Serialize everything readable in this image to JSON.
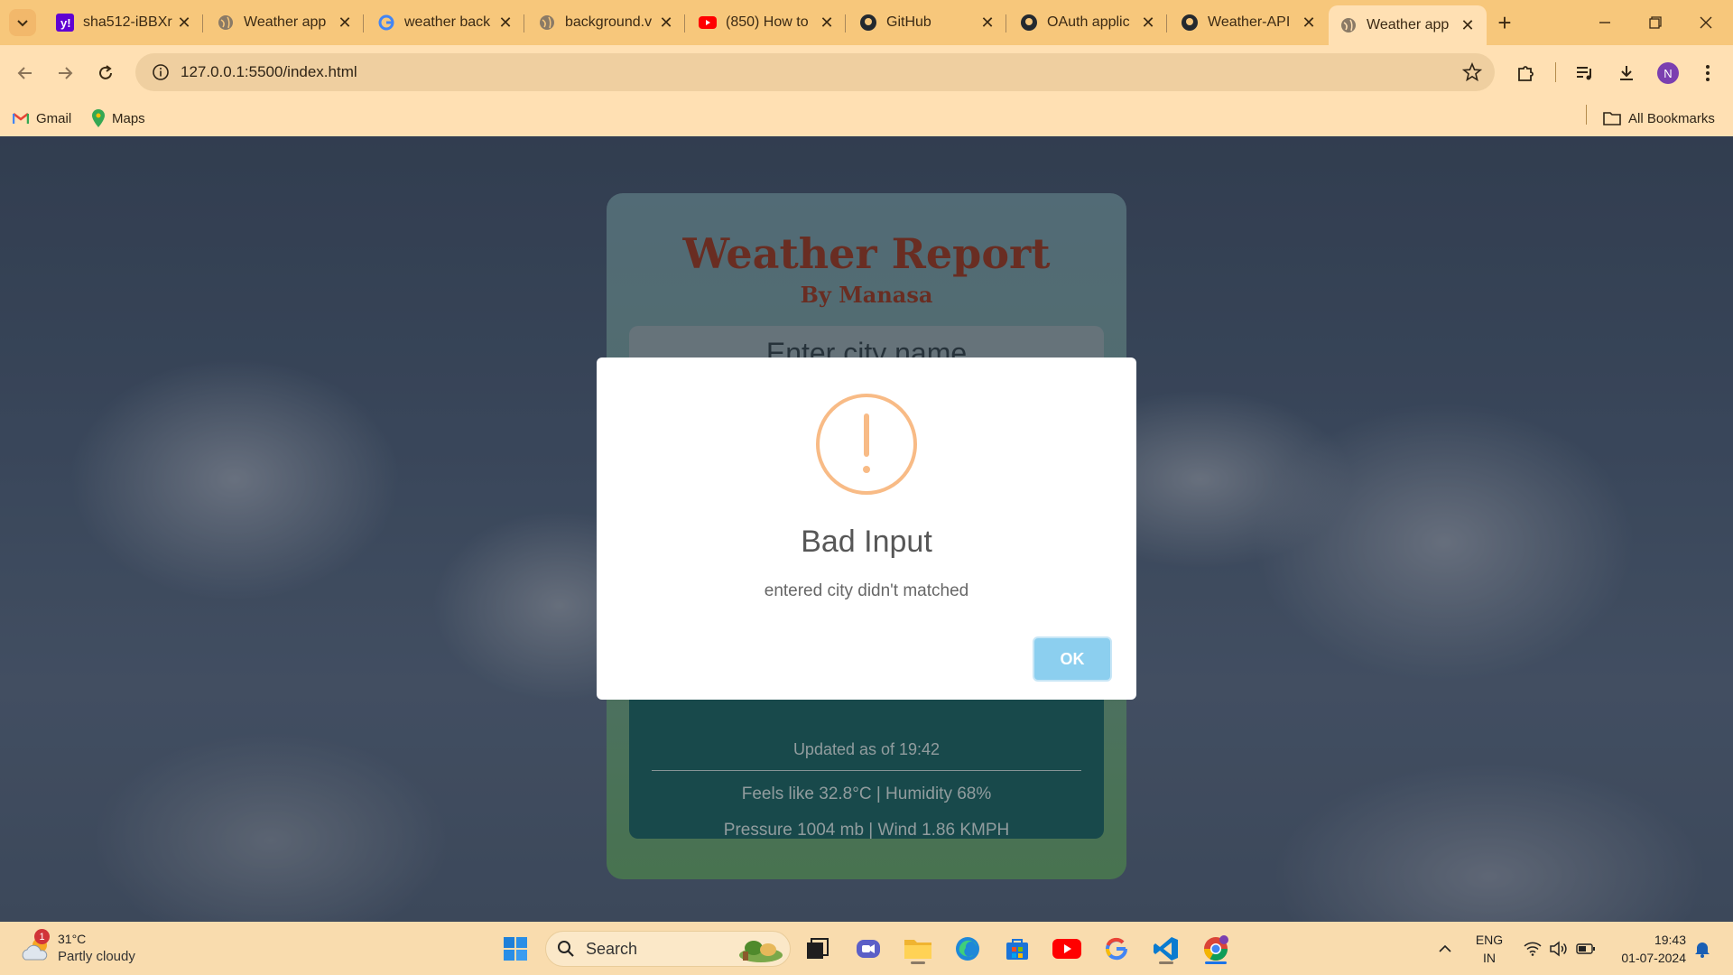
{
  "browser": {
    "tabs": [
      {
        "title": "sha512-iBBXr",
        "icon": "yahoo-icon"
      },
      {
        "title": "Weather app",
        "icon": "globe-icon"
      },
      {
        "title": "weather back",
        "icon": "google-icon"
      },
      {
        "title": "background.v",
        "icon": "globe-icon"
      },
      {
        "title": "(850) How to",
        "icon": "youtube-icon"
      },
      {
        "title": "GitHub",
        "icon": "github-icon"
      },
      {
        "title": "OAuth applic",
        "icon": "github-icon"
      },
      {
        "title": "Weather-API",
        "icon": "github-icon"
      },
      {
        "title": "Weather app",
        "icon": "globe-icon"
      }
    ],
    "active_tab_index": 8,
    "url": "127.0.0.1:5500/index.html",
    "profile_initial": "N",
    "bookmarks": [
      {
        "label": "Gmail",
        "icon": "gmail-icon"
      },
      {
        "label": "Maps",
        "icon": "maps-icon"
      }
    ],
    "all_bookmarks_label": "All Bookmarks"
  },
  "app": {
    "title": "Weather Report",
    "subtitle": "By Manasa",
    "city_placeholder": "Enter city name",
    "updated_text": "Updated as of 19:42",
    "feels_line": "Feels like 32.8°C | Humidity 68%",
    "pressure_line": "Pressure 1004 mb | Wind 1.86 KMPH"
  },
  "modal": {
    "icon": "warning-icon",
    "title": "Bad Input",
    "text": "entered city didn't matched",
    "ok_label": "OK",
    "accent_color": "#f8bb86",
    "button_color": "#8ccfef"
  },
  "taskbar": {
    "weather_temp": "31°C",
    "weather_condition": "Partly cloudy",
    "weather_badge": "1",
    "search_label": "Search",
    "language_top": "ENG",
    "language_bottom": "IN",
    "time": "19:43",
    "date": "01-07-2024"
  }
}
